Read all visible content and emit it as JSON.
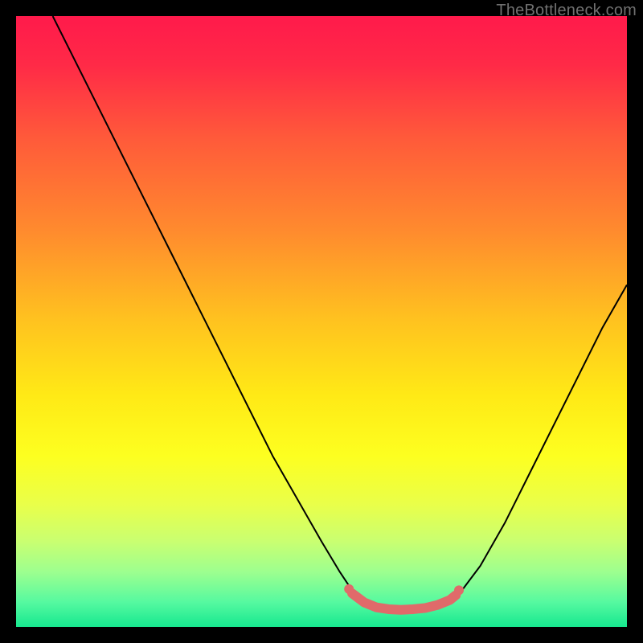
{
  "watermark": "TheBottleneck.com",
  "chart_data": {
    "type": "line",
    "title": "",
    "xlabel": "",
    "ylabel": "",
    "xlim": [
      0,
      100
    ],
    "ylim": [
      0,
      100
    ],
    "grid": false,
    "legend": false,
    "background_gradient": {
      "stops": [
        {
          "offset": 0.0,
          "color": "#ff1a4b"
        },
        {
          "offset": 0.08,
          "color": "#ff2a47"
        },
        {
          "offset": 0.2,
          "color": "#ff5a3a"
        },
        {
          "offset": 0.35,
          "color": "#ff8a2e"
        },
        {
          "offset": 0.5,
          "color": "#ffc31f"
        },
        {
          "offset": 0.62,
          "color": "#ffe916"
        },
        {
          "offset": 0.72,
          "color": "#fdff20"
        },
        {
          "offset": 0.8,
          "color": "#e9ff4a"
        },
        {
          "offset": 0.86,
          "color": "#c9ff71"
        },
        {
          "offset": 0.91,
          "color": "#9dff8f"
        },
        {
          "offset": 0.96,
          "color": "#55f9a0"
        },
        {
          "offset": 1.0,
          "color": "#17e88f"
        }
      ]
    },
    "series": [
      {
        "name": "curve-left",
        "stroke": "#000000",
        "stroke_width": 2,
        "type": "line",
        "x": [
          6,
          10,
          14,
          18,
          22,
          26,
          30,
          34,
          38,
          42,
          46,
          50,
          53,
          55,
          56.5
        ],
        "y": [
          100,
          92,
          84,
          76,
          68,
          60,
          52,
          44,
          36,
          28,
          21,
          14,
          9,
          6,
          4.5
        ]
      },
      {
        "name": "curve-right",
        "stroke": "#000000",
        "stroke_width": 2,
        "type": "line",
        "x": [
          71,
          73,
          76,
          80,
          84,
          88,
          92,
          96,
          100
        ],
        "y": [
          4.5,
          6,
          10,
          17,
          25,
          33,
          41,
          49,
          56
        ]
      },
      {
        "name": "valley-floor",
        "stroke": "#e06a6a",
        "stroke_width": 12,
        "linecap": "round",
        "type": "line",
        "x": [
          55,
          57,
          59,
          61,
          63,
          65,
          67,
          69,
          71,
          72
        ],
        "y": [
          5.5,
          4.0,
          3.2,
          2.9,
          2.8,
          2.9,
          3.1,
          3.6,
          4.4,
          5.2
        ]
      },
      {
        "name": "valley-dot-left",
        "stroke": "#e06a6a",
        "type": "marker",
        "x": [
          54.5
        ],
        "y": [
          6.2
        ],
        "r": 6
      },
      {
        "name": "valley-dot-right",
        "stroke": "#e06a6a",
        "type": "marker",
        "x": [
          72.5
        ],
        "y": [
          6.0
        ],
        "r": 6
      }
    ]
  }
}
